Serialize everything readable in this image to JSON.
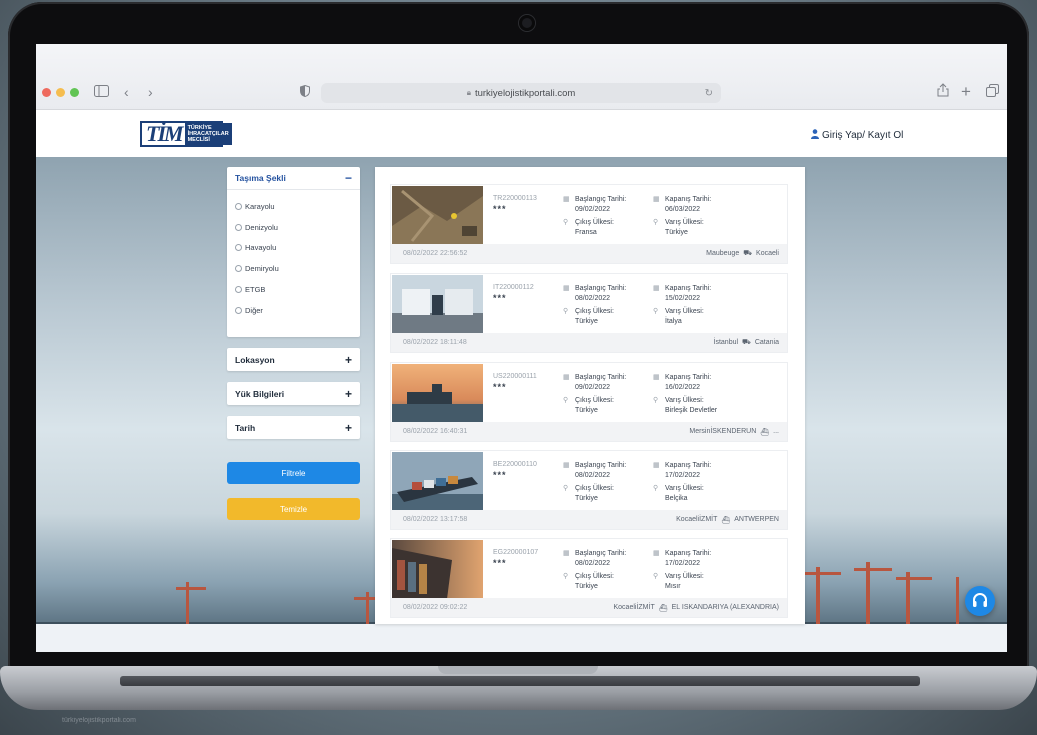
{
  "browser": {
    "url": "turkiyelojistikportali.com"
  },
  "header": {
    "logo": {
      "mark": "TİM",
      "line1": "TÜRKİYE",
      "line2": "İHRACATÇILAR",
      "line3": "MECLİSİ"
    },
    "login_label": "Giriş Yap/ Kayıt Ol"
  },
  "sidebar": {
    "transport": {
      "title": "Taşıma Şekli",
      "options": [
        "Karayolu",
        "Denizyolu",
        "Havayolu",
        "Demiryolu",
        "ETGB",
        "Diğer"
      ]
    },
    "location": {
      "title": "Lokasyon"
    },
    "cargo": {
      "title": "Yük Bilgileri"
    },
    "date": {
      "title": "Tarih"
    },
    "filter_label": "Filtrele",
    "clear_label": "Temizle"
  },
  "labels": {
    "start": "Başlangıç Tarihi:",
    "close": "Kapanış Tarihi:",
    "origin": "Çıkış Ülkesi:",
    "dest": "Varış Ülkesi:"
  },
  "results": [
    {
      "code": "TR220000113",
      "stars": "***",
      "start": "09/02/2022",
      "close": "06/03/2022",
      "origin": "Fransa",
      "dest": "Türkiye",
      "posted": "08/02/2022 22:56:52",
      "from": "Maubeuge",
      "to": "Kocaeli",
      "vehicle": "truck-icon",
      "img": "aerial"
    },
    {
      "code": "IT220000112",
      "stars": "***",
      "start": "08/02/2022",
      "close": "15/02/2022",
      "origin": "Türkiye",
      "dest": "İtalya",
      "posted": "08/02/2022 18:11:48",
      "from": "İstanbul",
      "to": "Catania",
      "vehicle": "truck-icon",
      "img": "trucks"
    },
    {
      "code": "US220000111",
      "stars": "***",
      "start": "09/02/2022",
      "close": "16/02/2022",
      "origin": "Türkiye",
      "dest": "Birleşik Devletler",
      "posted": "08/02/2022 16:40:31",
      "from": "MersinİSKENDERUN",
      "to": "...",
      "vehicle": "ship-icon",
      "img": "sunset-port"
    },
    {
      "code": "BE220000110",
      "stars": "***",
      "start": "08/02/2022",
      "close": "17/02/2022",
      "origin": "Türkiye",
      "dest": "Belçika",
      "posted": "08/02/2022 13:17:58",
      "from": "KocaeliİZMİT",
      "to": "ANTWERPEN",
      "vehicle": "ship-icon",
      "img": "container-ship"
    },
    {
      "code": "EG220000107",
      "stars": "***",
      "start": "08/02/2022",
      "close": "17/02/2022",
      "origin": "Türkiye",
      "dest": "Mısır",
      "posted": "08/02/2022 09:02:22",
      "from": "KocaeliİZMİT",
      "to": "EL ISKANDARIYA (ALEXANDRIA)",
      "vehicle": "ship-icon",
      "img": "ship-bow"
    }
  ],
  "caption": "türkiyelojistikportali.com"
}
